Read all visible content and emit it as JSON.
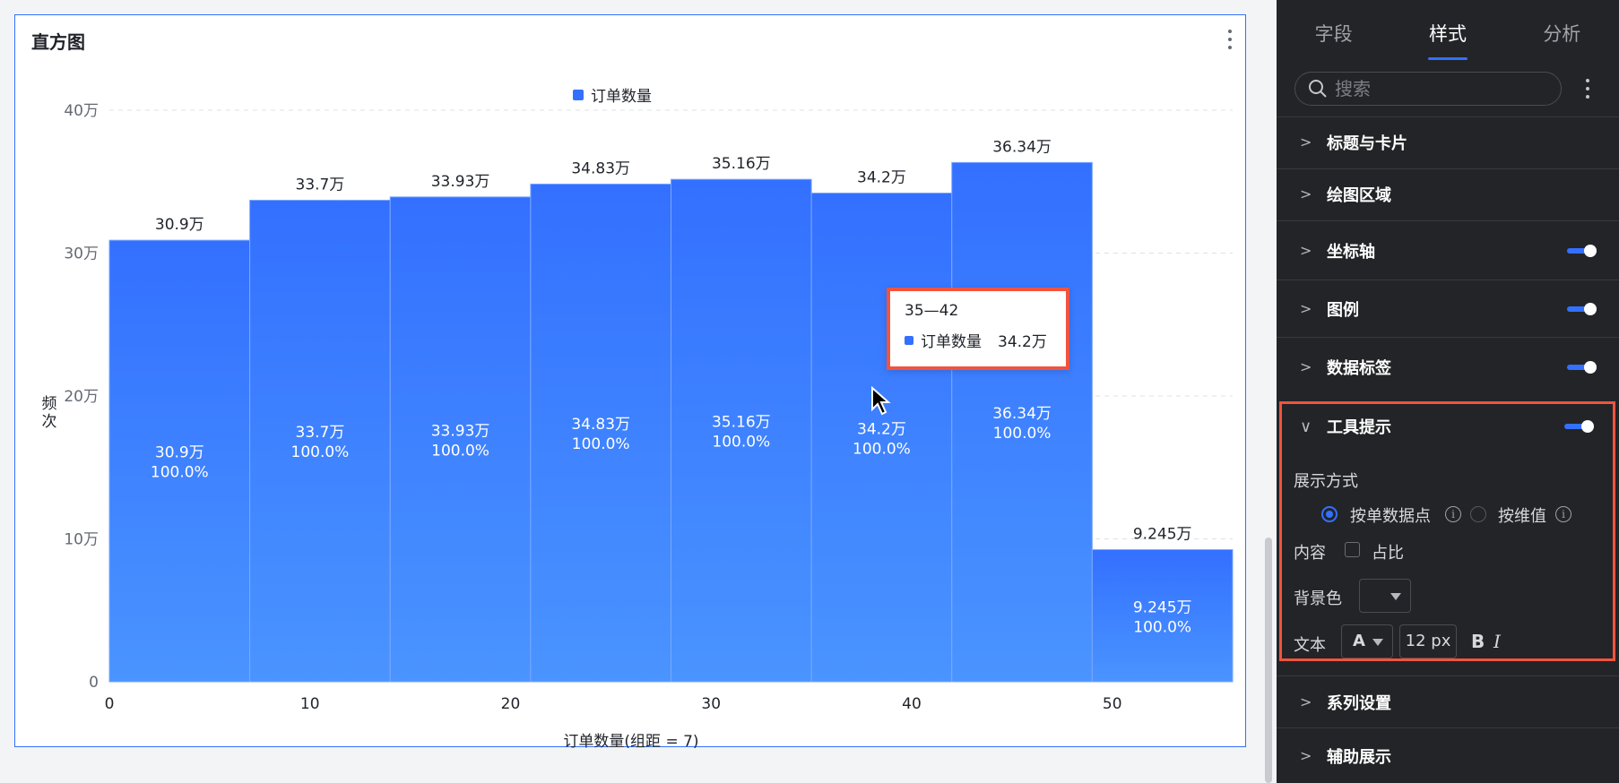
{
  "card": {
    "title": "直方图"
  },
  "chart_data": {
    "type": "bar",
    "categories": [
      "0-7",
      "7-14",
      "14-21",
      "21-28",
      "28-35",
      "35-42",
      "42-49",
      "49-56"
    ],
    "values": [
      309000,
      337000,
      339300,
      348300,
      351600,
      342000,
      363400,
      92450
    ],
    "value_labels": [
      "30.9万",
      "33.7万",
      "33.93万",
      "34.83万",
      "35.16万",
      "34.2万",
      "36.34万",
      "9.245万"
    ],
    "percent_labels": [
      "100.0%",
      "100.0%",
      "100.0%",
      "100.0%",
      "100.0%",
      "100.0%",
      "100.0%",
      "100.0%"
    ],
    "series": [
      {
        "name": "订单数量"
      }
    ],
    "x_ticks": [
      "0",
      "10",
      "20",
      "30",
      "40",
      "50"
    ],
    "x_tick_values": [
      0,
      10,
      20,
      30,
      40,
      50
    ],
    "xlim": [
      0,
      56
    ],
    "y_ticks": [
      "0",
      "10万",
      "20万",
      "30万",
      "40万"
    ],
    "ylim": [
      0,
      400000
    ],
    "xlabel": "订单数量(组距 = 7)",
    "ylabel": "频次",
    "legend_position": "top-center",
    "grid": true,
    "bar_color": "#3370ff"
  },
  "tooltip": {
    "title": "35—42",
    "series": "订单数量",
    "value": "34.2万"
  },
  "panel": {
    "tabs": [
      "字段",
      "样式",
      "分析"
    ],
    "active_tab": "样式",
    "search_placeholder": "搜索",
    "sections_top": [
      "标题与卡片",
      "绘图区域",
      "坐标轴",
      "图例",
      "数据标签"
    ],
    "tooltip_section": {
      "title": "工具提示",
      "display_mode_label": "展示方式",
      "option_single": "按单数据点",
      "option_dimension": "按维值",
      "content_label": "内容",
      "content_option": "占比",
      "bg_label": "背景色",
      "text_label": "文本",
      "font_color_glyph": "A",
      "font_size": "12 px",
      "bold": "B",
      "italic": "I"
    },
    "sections_bottom": [
      "系列设置",
      "辅助展示"
    ],
    "accent_color": "#3370ff",
    "highlight_color": "#f0543e"
  }
}
